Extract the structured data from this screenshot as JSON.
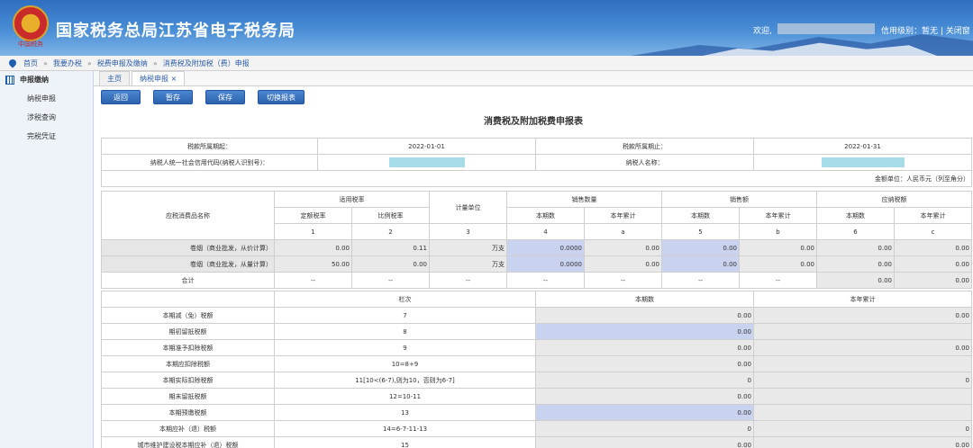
{
  "header": {
    "title": "国家税务总局江苏省电子税务局",
    "emblem_text": "中国税务",
    "welcome": "欢迎,",
    "user_links": "信用级别：暂无 | 关闭窗"
  },
  "breadcrumb": [
    "首页",
    "我要办税",
    "税费申报及缴纳",
    "消费税及附加税（费）申报"
  ],
  "sidebar": {
    "header": "申报缴纳",
    "items": [
      "纳税申报",
      "涉税查询",
      "完税凭证"
    ]
  },
  "tabs": [
    {
      "label": "主页",
      "active": false
    },
    {
      "label": "纳税申报 ×",
      "active": true
    }
  ],
  "toolbar": [
    "返回",
    "暂存",
    "保存",
    "切换报表"
  ],
  "form_title": "消费税及附加税费申报表",
  "info": {
    "period_start_label": "税款所属期起：",
    "period_start_value": "2022-01-01",
    "period_end_label": "税款所属期止：",
    "period_end_value": "2022-01-31",
    "taxpayer_id_label": "纳税人统一社会信用代码(纳税人识别号)：",
    "taxpayer_name_label": "纳税人名称：",
    "unit_note": "金额单位：人民币元（列至角分）"
  },
  "table1": {
    "name_header": "应税消费品名称",
    "rate_header": "适用税率",
    "rate_fixed": "定额税率",
    "rate_ratio": "比例税率",
    "unit_header": "计量单位",
    "qty_header": "销售数量",
    "amount_header": "销售额",
    "tax_header": "应纳税额",
    "current": "本期数",
    "ytd": "本年累计",
    "codes": [
      "1",
      "2",
      "3",
      "4",
      "a",
      "5",
      "b",
      "6",
      "c"
    ],
    "rows": [
      {
        "name": "卷烟（商业批发，从价计算）",
        "fixed": "0.00",
        "ratio": "0.11",
        "unit": "万支",
        "qty": "0.0000",
        "qty_ytd": "0.00",
        "amt": "0.00",
        "amt_ytd": "0.00",
        "tax": "0.00",
        "tax_ytd": "0.00"
      },
      {
        "name": "卷烟（商业批发，从量计算）",
        "fixed": "50.00",
        "ratio": "0.00",
        "unit": "万支",
        "qty": "0.0000",
        "qty_ytd": "0.00",
        "amt": "0.00",
        "amt_ytd": "0.00",
        "tax": "0.00",
        "tax_ytd": "0.00"
      },
      {
        "name": "合计",
        "fixed": "--",
        "ratio": "--",
        "unit": "--",
        "qty": "--",
        "qty_ytd": "--",
        "amt": "--",
        "amt_ytd": "--",
        "tax": "0.00",
        "tax_ytd": "0.00"
      }
    ]
  },
  "table2": {
    "header_seq": "栏次",
    "header_current": "本期数",
    "header_ytd": "本年累计",
    "rows": [
      {
        "label": "本期减（免）税额",
        "seq": "7",
        "cur": "0.00",
        "ytd": "0.00"
      },
      {
        "label": "期初留抵税额",
        "seq": "8",
        "cur": "0.00",
        "ytd": ""
      },
      {
        "label": "本期准予扣除税额",
        "seq": "9",
        "cur": "0.00",
        "ytd": "0.00"
      },
      {
        "label": "本期应扣除税额",
        "seq": "10=8+9",
        "cur": "0.00",
        "ytd": ""
      },
      {
        "label": "本期实际扣除税额",
        "seq": "11[10<(6-7),则为10，否则为6-7]",
        "cur": "0",
        "ytd": "0"
      },
      {
        "label": "期末留抵税额",
        "seq": "12=10-11",
        "cur": "0.00",
        "ytd": ""
      },
      {
        "label": "本期预缴税额",
        "seq": "13",
        "cur": "0.00",
        "ytd": ""
      },
      {
        "label": "本期应补（退）税额",
        "seq": "14=6-7-11-13",
        "cur": "0",
        "ytd": "0"
      },
      {
        "label": "城市维护建设税本期应补（退）税额",
        "seq": "15",
        "cur": "0.00",
        "ytd": "0.00"
      }
    ]
  },
  "colors": {
    "header_blue": "#2f6fc0",
    "button_blue": "#2c62ad",
    "input_blue": "#c9d3f0",
    "masked_field": "#a6dbe8"
  }
}
